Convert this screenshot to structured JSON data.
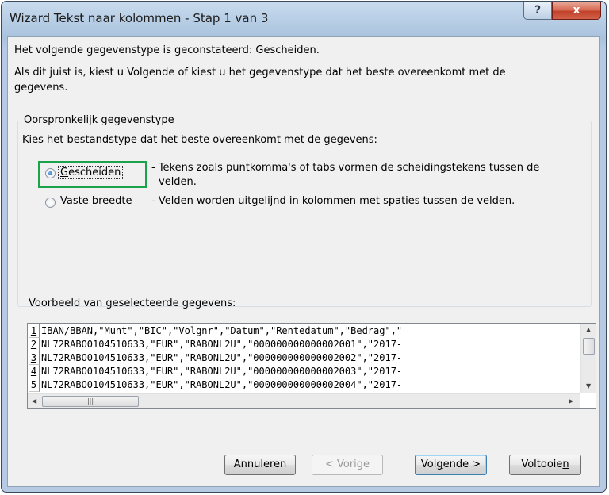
{
  "window": {
    "title": "Wizard Tekst naar kolommen - Stap 1 van 3",
    "help_label": "?",
    "close_label": "x"
  },
  "intro": {
    "line1": "Het volgende gegevenstype is geconstateerd: Gescheiden.",
    "line2": "Als dit juist is, kiest u Volgende of kiest u het gegevenstype dat het beste overeenkomt met de",
    "line3": "gegevens."
  },
  "group": {
    "label": "Oorspronkelijk gegevenstype",
    "prompt": "Kies het bestandstype dat het beste overeenkomt met de gegevens:",
    "options": [
      {
        "label_pre": "",
        "label_u": "G",
        "label_post": "escheiden",
        "desc1": "- Tekens zoals puntkomma's of tabs vormen de scheidingstekens tussen de",
        "desc2": "velden.",
        "checked": true
      },
      {
        "label_pre": "Vaste ",
        "label_u": "b",
        "label_post": "reedte",
        "desc1": "- Velden worden uitgelijnd in kolommen met spaties tussen de velden.",
        "desc2": "",
        "checked": false
      }
    ]
  },
  "preview": {
    "label": "Voorbeeld van geselecteerde gegevens:",
    "rows": [
      {
        "num": "1",
        "text": "IBAN/BBAN,\"Munt\",\"BIC\",\"Volgnr\",\"Datum\",\"Rentedatum\",\"Bedrag\",\""
      },
      {
        "num": "2",
        "text": "NL72RABO0104510633,\"EUR\",\"RABONL2U\",\"000000000000002001\",\"2017-"
      },
      {
        "num": "3",
        "text": "NL72RABO0104510633,\"EUR\",\"RABONL2U\",\"000000000000002002\",\"2017-"
      },
      {
        "num": "4",
        "text": "NL72RABO0104510633,\"EUR\",\"RABONL2U\",\"000000000000002003\",\"2017-"
      },
      {
        "num": "5",
        "text": "NL72RABO0104510633,\"EUR\",\"RABONL2U\",\"000000000000002004\",\"2017-"
      }
    ]
  },
  "buttons": {
    "cancel": "Annuleren",
    "back": "< Vorige",
    "next_pre": "Vol",
    "next_u": "g",
    "next_post": "ende >",
    "finish_pre": "Voltooie",
    "finish_u": "n",
    "finish_post": ""
  }
}
